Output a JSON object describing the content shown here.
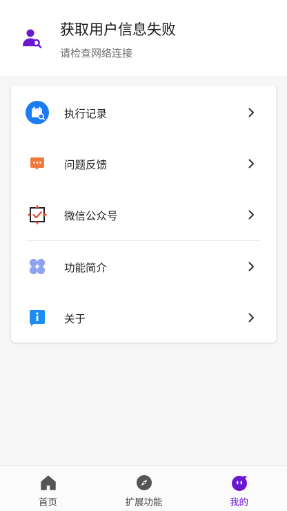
{
  "header": {
    "title": "获取用户信息失败",
    "subtitle": "请检查网络连接",
    "avatar_icon": "user-search-icon",
    "accent_color": "#6a16d4"
  },
  "menu": {
    "items": [
      {
        "label": "执行记录",
        "icon": "calendar-search-icon",
        "icon_color": "#1d7cf2"
      },
      {
        "label": "问题反馈",
        "icon": "chat-bubble-icon",
        "icon_color": "#f07a3c"
      },
      {
        "label": "微信公众号",
        "icon": "check-frame-icon",
        "icon_color": "#e44a2e"
      },
      {
        "label": "功能简介",
        "icon": "grid-petals-icon",
        "icon_color": "#8fa3f0"
      },
      {
        "label": "关于",
        "icon": "info-bubble-icon",
        "icon_color": "#1d8ef0"
      }
    ]
  },
  "tabbar": {
    "tabs": [
      {
        "label": "首页",
        "icon": "home-icon",
        "active": false
      },
      {
        "label": "扩展功能",
        "icon": "compass-icon",
        "active": false
      },
      {
        "label": "我的",
        "icon": "mascot-icon",
        "active": true
      }
    ],
    "active_color": "#6a16d4",
    "inactive_color": "#555555"
  }
}
